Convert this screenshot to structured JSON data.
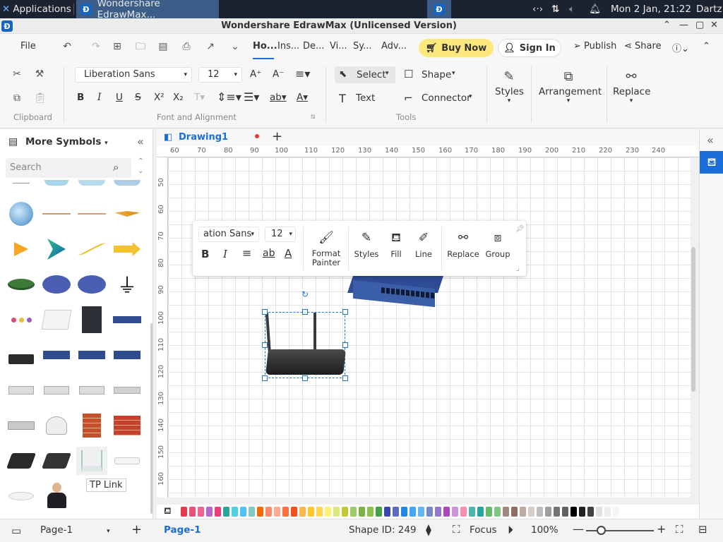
{
  "taskbar": {
    "applications": "Applications",
    "window_title": "Wondershare EdrawMax...",
    "clock": "Mon  2 Jan, 21:22",
    "user": "Dartz"
  },
  "titlebar": {
    "title": "Wondershare EdrawMax (Unlicensed Version)"
  },
  "menu": {
    "file": "File",
    "tabs": [
      "Ho...",
      "Ins...",
      "De...",
      "Vi...",
      "Sy...",
      "Adv..."
    ],
    "buy_now": "Buy Now",
    "sign_in": "Sign In",
    "publish": "Publish",
    "share": "Share"
  },
  "ribbon": {
    "font_family": "Liberation Sans",
    "font_size": "12",
    "groups": {
      "clipboard": "Clipboard",
      "font": "Font and Alignment",
      "tools": "Tools"
    },
    "select": "Select",
    "shape": "Shape",
    "text": "Text",
    "connector": "Connector",
    "styles": "Styles",
    "arrangement": "Arrangement",
    "replace": "Replace"
  },
  "library": {
    "title": "More Symbols",
    "search_placeholder": "Search",
    "tooltip": "TP Link"
  },
  "document": {
    "tab": "Drawing1"
  },
  "ruler_x": [
    "60",
    "70",
    "80",
    "90",
    "100",
    "110",
    "120",
    "130",
    "140",
    "150",
    "160",
    "170",
    "180",
    "190",
    "200",
    "210",
    "220",
    "230",
    "240"
  ],
  "ruler_y": [
    "50",
    "60",
    "70",
    "80",
    "90",
    "100",
    "110",
    "120",
    "130",
    "140",
    "150",
    "160"
  ],
  "floatbar": {
    "font": "ation Sans",
    "size": "12",
    "format_painter": "Format Painter",
    "styles": "Styles",
    "fill": "Fill",
    "line": "Line",
    "replace": "Replace",
    "group": "Group"
  },
  "status": {
    "page_select": "Page-1",
    "page_tab": "Page-1",
    "shape_id": "Shape ID: 249",
    "focus": "Focus",
    "zoom": "100%"
  },
  "palette": [
    "#e53950",
    "#e8507a",
    "#f06292",
    "#ba68c8",
    "#ec407a",
    "#26a69a",
    "#4dd0e1",
    "#4fc3f7",
    "#80cbc4",
    "#ef6c00",
    "#ff8a65",
    "#ffab91",
    "#ff7043",
    "#f4511e",
    "#ffb74d",
    "#ffca28",
    "#ffd54f",
    "#fff176",
    "#dce775",
    "#c0ca33",
    "#9ccc65",
    "#7cb342",
    "#8bc34a",
    "#43a047",
    "#3949ab",
    "#5c6bc0",
    "#1e88e5",
    "#42a5f5",
    "#64b5f6",
    "#7986cb",
    "#9575cd",
    "#ab47bc",
    "#ce93d8",
    "#f48fb1",
    "#4db6ac",
    "#26a69a",
    "#66bb6a",
    "#81c784",
    "#a1887f",
    "#8d6e63",
    "#bcaaa4",
    "#d7ccc8",
    "#bdbdbd",
    "#9e9e9e",
    "#757575",
    "#616161",
    "#000000",
    "#212121",
    "#424242",
    "#e0e0e0",
    "#eeeeee",
    "#f5f5f5"
  ]
}
